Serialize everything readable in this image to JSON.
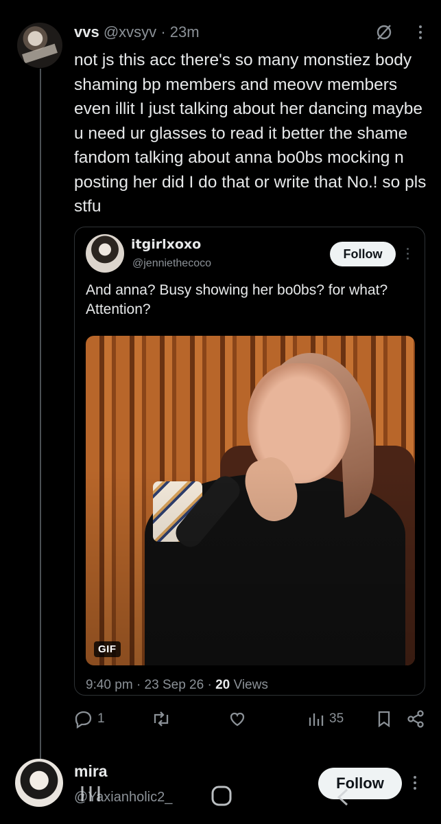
{
  "post": {
    "display_name": "vvs",
    "handle": "@xvsyv",
    "separator": "·",
    "time": "23m",
    "text": "not js this acc there's so many monstiez body shaming bp members and meovv members even illit I just talking about her dancing maybe u need ur glasses to read it better the shame fandom talking about anna bo0bs mocking n posting her did I do that or write that No.! so pls stfu",
    "icons": [
      "grok-icon",
      "more-icon"
    ]
  },
  "quote": {
    "display_name": "itgirlxoxo",
    "handle": "@jenniethecoco",
    "follow_label": "Follow",
    "text": "And anna? Busy showing her bo0bs? for what? Attention?",
    "media_badge": "GIF",
    "time": "9:40 pm",
    "date": "23 Sep 26",
    "views_count": "20",
    "views_label": "Views"
  },
  "actions": {
    "reply_count": "1",
    "repost_count": "",
    "like_count": "",
    "views_count": "35",
    "icons": [
      "reply-icon",
      "repost-icon",
      "like-icon",
      "views-icon",
      "bookmark-icon",
      "share-icon"
    ]
  },
  "reply_preview": {
    "display_name": "mira",
    "handle": "@Yaxianholic2_",
    "follow_label": "Follow"
  },
  "colors": {
    "background": "#000000",
    "text_primary": "#e7e9ea",
    "text_secondary": "#8b9197",
    "border": "#2f3336",
    "follow_bg": "#eff3f4"
  }
}
